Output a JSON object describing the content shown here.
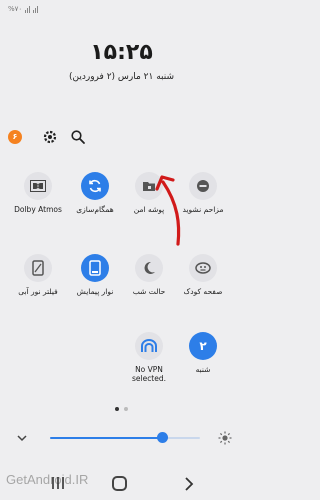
{
  "status_bar": {
    "text": "%۷۰"
  },
  "clock": {
    "time": "۱۵:۲۵"
  },
  "date": {
    "text": "شنبه ۲۱ مارس (۲ فروردین)"
  },
  "notifications": {
    "badge": "۶",
    "badge_color": "#f58220"
  },
  "accent_color": "#2d7ee8",
  "tiles_row1": [
    {
      "label": "مزاحم نشوید",
      "icon": "do-not-disturb-icon",
      "active": false
    },
    {
      "label": "پوشه امن",
      "icon": "secure-folder-icon",
      "active": false
    },
    {
      "label": "همگام‌سازی",
      "icon": "sync-icon",
      "active": true
    },
    {
      "label": "Dolby Atmos",
      "icon": "dolby-icon",
      "active": false
    }
  ],
  "tiles_row2": [
    {
      "label": "صفحه کودک",
      "icon": "kids-home-icon",
      "active": false
    },
    {
      "label": "حالت شب",
      "icon": "night-mode-icon",
      "active": false
    },
    {
      "label": "نوار پیمایش",
      "icon": "navigation-bar-icon",
      "active": true
    },
    {
      "label": "فیلتر نور آبی",
      "icon": "blue-light-filter-icon",
      "active": false
    }
  ],
  "tiles_row3": [
    {
      "label": "شنبه",
      "icon": "calendar-day-icon",
      "badge": "۲",
      "active": true
    },
    {
      "label": "No VPN selected.",
      "icon": "vpn-icon",
      "active": false
    }
  ],
  "pager": {
    "pages": 2,
    "current": 1
  },
  "brightness": {
    "level": 0.75
  },
  "watermark": {
    "text": "GetAndroid.IR"
  }
}
